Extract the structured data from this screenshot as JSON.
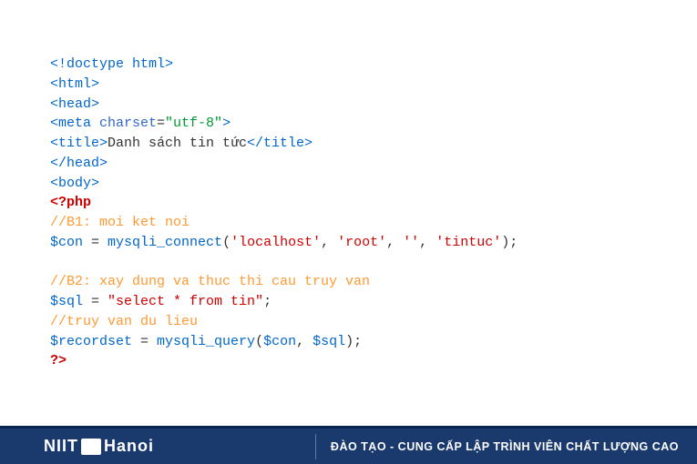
{
  "code": {
    "doctype": "<!doctype html>",
    "html_open": "<html>",
    "head_open": "<head>",
    "meta_tag": "<meta ",
    "meta_attr": "charset",
    "meta_eq": "=",
    "meta_val": "\"utf-8\"",
    "meta_close": ">",
    "title_open": "<title>",
    "title_text": "Danh sách tin tức",
    "title_close": "</title>",
    "head_close": "</head>",
    "body_open": "<body>",
    "php_open": "<?php",
    "comment1": "//B1: moi ket noi",
    "var_con": "$con",
    "assign1": " = ",
    "func_connect": "mysqli_connect",
    "paren_open1": "(",
    "str_localhost": "'localhost'",
    "comma": ", ",
    "str_root": "'root'",
    "str_empty": "''",
    "str_tintuc": "'tintuc'",
    "paren_close1": ");",
    "comment2": "//B2: xay dung va thuc thi cau truy van",
    "var_sql": "$sql",
    "assign2": " = ",
    "str_select": "\"select * from tin\"",
    "semi": ";",
    "comment3": "//truy van du lieu",
    "var_recordset": "$recordset",
    "assign3": " = ",
    "func_query": "mysqli_query",
    "paren_open2": "(",
    "var_con2": "$con",
    "var_sql2": "$sql",
    "paren_close2": ");",
    "php_close": "?>"
  },
  "footer": {
    "logo_left": "NIIT",
    "logo_right": "Hanoi",
    "tagline": "ĐÀO TẠO - CUNG CẤP LẬP TRÌNH VIÊN CHẤT LƯỢNG CAO"
  }
}
